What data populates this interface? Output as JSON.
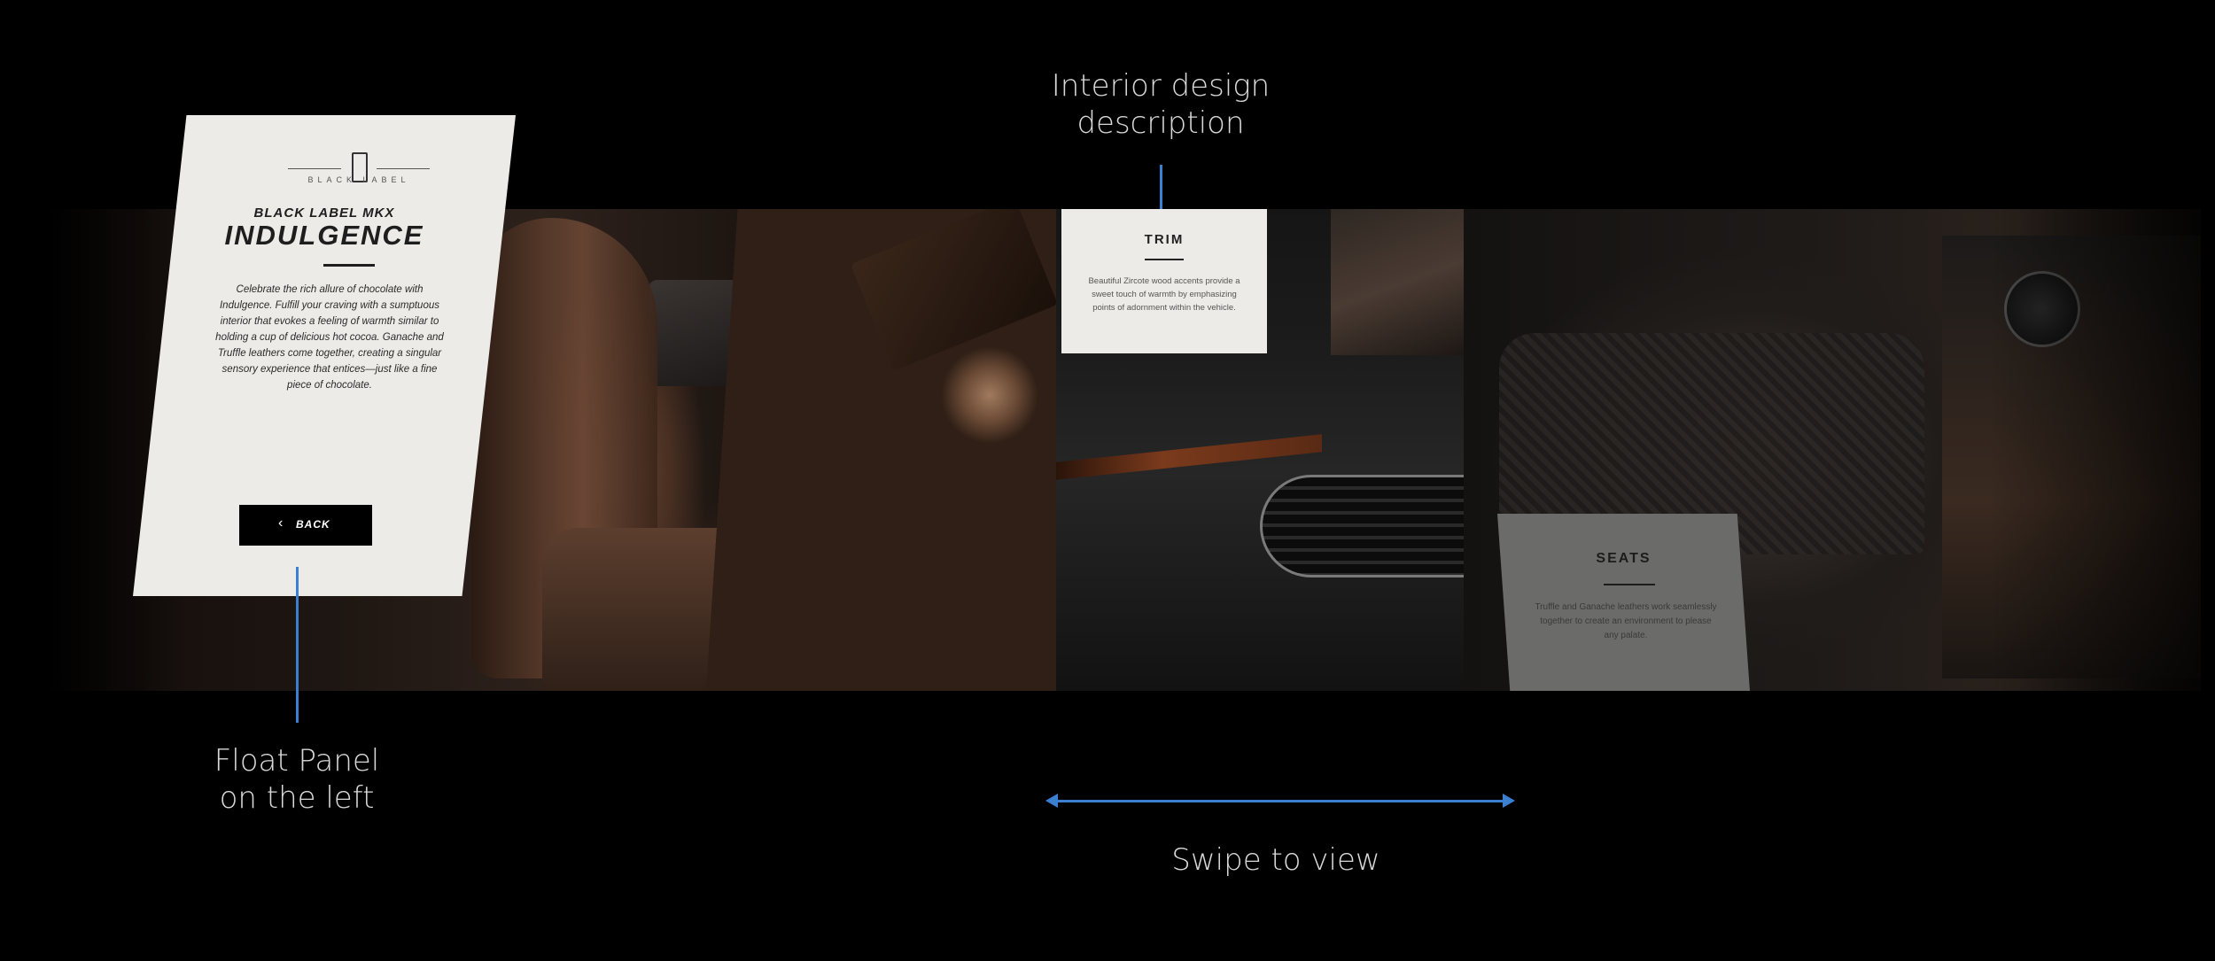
{
  "annotations": {
    "interior_design": [
      "Interior design",
      "description"
    ],
    "float_panel": [
      "Float Panel",
      "on the left"
    ],
    "swipe": "Swipe to view"
  },
  "panel": {
    "brand_text": "BLACK LABEL",
    "eyebrow": "BLACK LABEL MKX",
    "headline": "INDULGENCE",
    "body": "Celebrate the rich allure of chocolate with Indulgence. Fulfill your craving with a sumptuous interior that evokes a feeling of warmth similar to holding a cup of delicious hot cocoa. Ganache and Truffle leathers come together, creating a singular sensory experience that entices—just like a fine piece of chocolate.",
    "back_label": "BACK"
  },
  "trim": {
    "title": "TRIM",
    "description": "Beautiful Zircote wood accents provide a sweet touch of warmth by emphasizing points of adornment within the vehicle."
  },
  "seats": {
    "title": "SEATS",
    "description": "Truffle and Ganache leathers work seamlessly together to create an environment to please any palate."
  },
  "colors": {
    "background": "#000000",
    "panel": "#ecebe7",
    "annotation_line": "#3a7fd0",
    "button": "#000000"
  }
}
